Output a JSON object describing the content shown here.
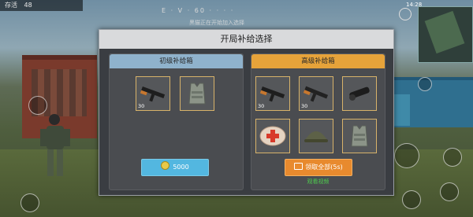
{
  "hud": {
    "alive_label": "存活",
    "alive_count": "48",
    "compass": "E  ·  V  ·  60  ·  ·  ·  ·",
    "team_message": "黑猫正在开始加入选择",
    "time": "14:28"
  },
  "dialog": {
    "title": "开局补给选择",
    "basic": {
      "title": "初级补给箱",
      "items": [
        {
          "name": "rifle",
          "icon": "rifle-icon",
          "qty": "30"
        },
        {
          "name": "vest",
          "icon": "vest-icon",
          "qty": ""
        }
      ],
      "button_label": "5000"
    },
    "advanced": {
      "title": "高级补给箱",
      "items": [
        {
          "name": "rifle",
          "icon": "rifle-icon",
          "qty": "30"
        },
        {
          "name": "rifle-2",
          "icon": "rifle-icon",
          "qty": "30"
        },
        {
          "name": "scope",
          "icon": "scope-icon",
          "qty": ""
        },
        {
          "name": "medkit",
          "icon": "medkit-icon",
          "qty": ""
        },
        {
          "name": "helmet",
          "icon": "helmet-icon",
          "qty": ""
        },
        {
          "name": "vest",
          "icon": "vest-icon",
          "qty": ""
        }
      ],
      "button_label": "领取全部(5s)",
      "subtext": "观看视频"
    }
  },
  "colors": {
    "basic_header": "#8fb2cc",
    "advanced_header": "#e6a33a",
    "coin_button": "#53b7e0",
    "ad_button": "#e88a2e",
    "item_border": "#d8b36a"
  }
}
